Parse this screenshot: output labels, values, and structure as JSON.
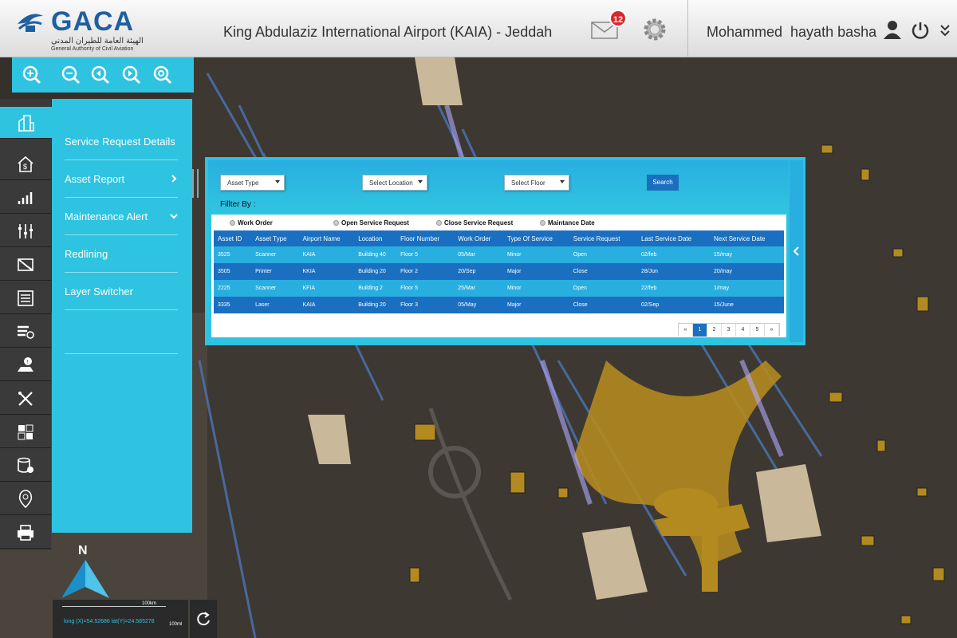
{
  "header": {
    "logo_text": "GACA",
    "logo_arabic": "الهيئة العامة للطيران المدني",
    "logo_english": "General Authority of Civil Aviation",
    "airport_title": "King Abdulaziz International Airport (KAIA) - Jeddah",
    "notification_count": "12",
    "username": "Mohammed  hayath basha",
    "icons": [
      "mail-icon",
      "gear-icon",
      "user-icon",
      "power-icon",
      "chevron-down-icon"
    ]
  },
  "zoom_toolbar": {
    "icons": [
      "zoom-in-icon",
      "zoom-out-icon",
      "pan-back-icon",
      "pan-forward-icon",
      "zoom-extent-icon"
    ]
  },
  "left_rail": {
    "icons": [
      "buildings-icon",
      "asset-icon",
      "chart-icon",
      "sliders-icon",
      "redline-icon",
      "report-icon",
      "layers-icon",
      "alert-icon",
      "tools-icon",
      "grid-icon",
      "database-icon",
      "location-pin-icon",
      "print-icon"
    ]
  },
  "menu": {
    "items": [
      {
        "label": "Service Request Details",
        "arrow": ""
      },
      {
        "label": "Asset Report",
        "arrow": "right"
      },
      {
        "label": "Maintenance  Alert",
        "arrow": "down"
      },
      {
        "label": "Redlining",
        "arrow": ""
      },
      {
        "label": "Layer Switcher",
        "arrow": ""
      },
      {
        "label": "",
        "arrow": ""
      }
    ]
  },
  "panel": {
    "filters": {
      "asset_type": "Asset Type",
      "location": "Select Location",
      "floor": "Select Floor",
      "search_label": "Search"
    },
    "filter_by_label": "Fillter By :",
    "radio_options": [
      "Work Order",
      "Open Service Request",
      "Close Service Request",
      "Maintance Date"
    ],
    "table": {
      "columns": [
        "Asset ID",
        "Asset Type",
        "Airport Name",
        "Location",
        "Floor Number",
        "Work Order",
        "Type Of Service",
        "Service Request",
        "Last Service Date",
        "Next Service Date"
      ],
      "rows": [
        [
          "3525",
          "Scanner",
          "KAIA",
          "Building 40",
          "Floor 5",
          "05/Mar",
          "Minor",
          "Open",
          "02/feb",
          "15/may"
        ],
        [
          "3505",
          "Printer",
          "KKIA",
          "Building 20",
          "Floor 2",
          "20/Sep",
          "Major",
          "Close",
          "28/Jun",
          "20/may"
        ],
        [
          "2225",
          "Scanner",
          "KFIA",
          "Building 2",
          "Floor 5",
          "25/Mar",
          "Minor",
          "Open",
          "22/feb",
          "1/may"
        ],
        [
          "3335",
          "Laser",
          "KAIA",
          "Building 20",
          "Floor 3",
          "05/May",
          "Major",
          "Close",
          "02/Sep",
          "15/June"
        ]
      ]
    },
    "pagination": {
      "prev": "«",
      "pages": [
        "1",
        "2",
        "3",
        "4",
        "5"
      ],
      "active": "1",
      "next": "»"
    }
  },
  "map_footer": {
    "north_label": "N",
    "scale_top": "100km",
    "coordinates": "long (X)=54.52686  lat(Y)=24.585278",
    "scale_bottom": "100ml"
  },
  "colors": {
    "accent": "#2ec3e0",
    "table_header": "#1a6fc0",
    "brand_blue": "#1f5fa0",
    "badge_red": "#d9262b"
  }
}
